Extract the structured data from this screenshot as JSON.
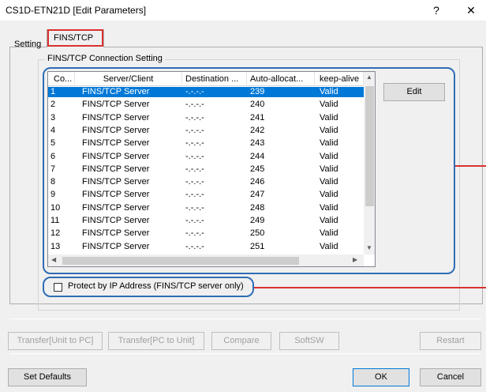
{
  "window": {
    "title": "CS1D-ETN21D [Edit Parameters]",
    "help_label": "?",
    "close_label": "✕"
  },
  "tabs": [
    {
      "label": "Setting",
      "active": false
    },
    {
      "label": "FINS/TCP",
      "active": true
    }
  ],
  "group": {
    "title": "FINS/TCP Connection Setting"
  },
  "table": {
    "columns": [
      "Co...",
      "Server/Client",
      "Destination ...",
      "Auto-allocat...",
      "keep-alive"
    ],
    "rows": [
      {
        "no": "1",
        "role": "FINS/TCP Server",
        "dest": "-.-.-.-",
        "auto": "239",
        "keep": "Valid",
        "selected": true
      },
      {
        "no": "2",
        "role": "FINS/TCP Server",
        "dest": "-.-.-.-",
        "auto": "240",
        "keep": "Valid"
      },
      {
        "no": "3",
        "role": "FINS/TCP Server",
        "dest": "-.-.-.-",
        "auto": "241",
        "keep": "Valid"
      },
      {
        "no": "4",
        "role": "FINS/TCP Server",
        "dest": "-.-.-.-",
        "auto": "242",
        "keep": "Valid"
      },
      {
        "no": "5",
        "role": "FINS/TCP Server",
        "dest": "-.-.-.-",
        "auto": "243",
        "keep": "Valid"
      },
      {
        "no": "6",
        "role": "FINS/TCP Server",
        "dest": "-.-.-.-",
        "auto": "244",
        "keep": "Valid"
      },
      {
        "no": "7",
        "role": "FINS/TCP Server",
        "dest": "-.-.-.-",
        "auto": "245",
        "keep": "Valid"
      },
      {
        "no": "8",
        "role": "FINS/TCP Server",
        "dest": "-.-.-.-",
        "auto": "246",
        "keep": "Valid"
      },
      {
        "no": "9",
        "role": "FINS/TCP Server",
        "dest": "-.-.-.-",
        "auto": "247",
        "keep": "Valid"
      },
      {
        "no": "10",
        "role": "FINS/TCP Server",
        "dest": "-.-.-.-",
        "auto": "248",
        "keep": "Valid"
      },
      {
        "no": "11",
        "role": "FINS/TCP Server",
        "dest": "-.-.-.-",
        "auto": "249",
        "keep": "Valid"
      },
      {
        "no": "12",
        "role": "FINS/TCP Server",
        "dest": "-.-.-.-",
        "auto": "250",
        "keep": "Valid"
      },
      {
        "no": "13",
        "role": "FINS/TCP Server",
        "dest": "-.-.-.-",
        "auto": "251",
        "keep": "Valid"
      }
    ]
  },
  "edit_button": "Edit",
  "protect_checkbox": {
    "label": "Protect by IP Address (FINS/TCP server only)",
    "checked": false
  },
  "transfer_buttons": {
    "unit_to_pc": "Transfer[Unit to PC]",
    "pc_to_unit": "Transfer[PC to Unit]",
    "compare": "Compare",
    "softsw": "SoftSW",
    "restart": "Restart"
  },
  "footer": {
    "set_defaults": "Set Defaults",
    "ok": "OK",
    "cancel": "Cancel"
  },
  "colors": {
    "highlight_red": "#d9322e",
    "highlight_blue": "#2f6db5",
    "selection": "#0078d7"
  },
  "icons": {
    "scroll_up": "▲",
    "scroll_down": "▼",
    "scroll_left": "◀",
    "scroll_right": "▶"
  }
}
